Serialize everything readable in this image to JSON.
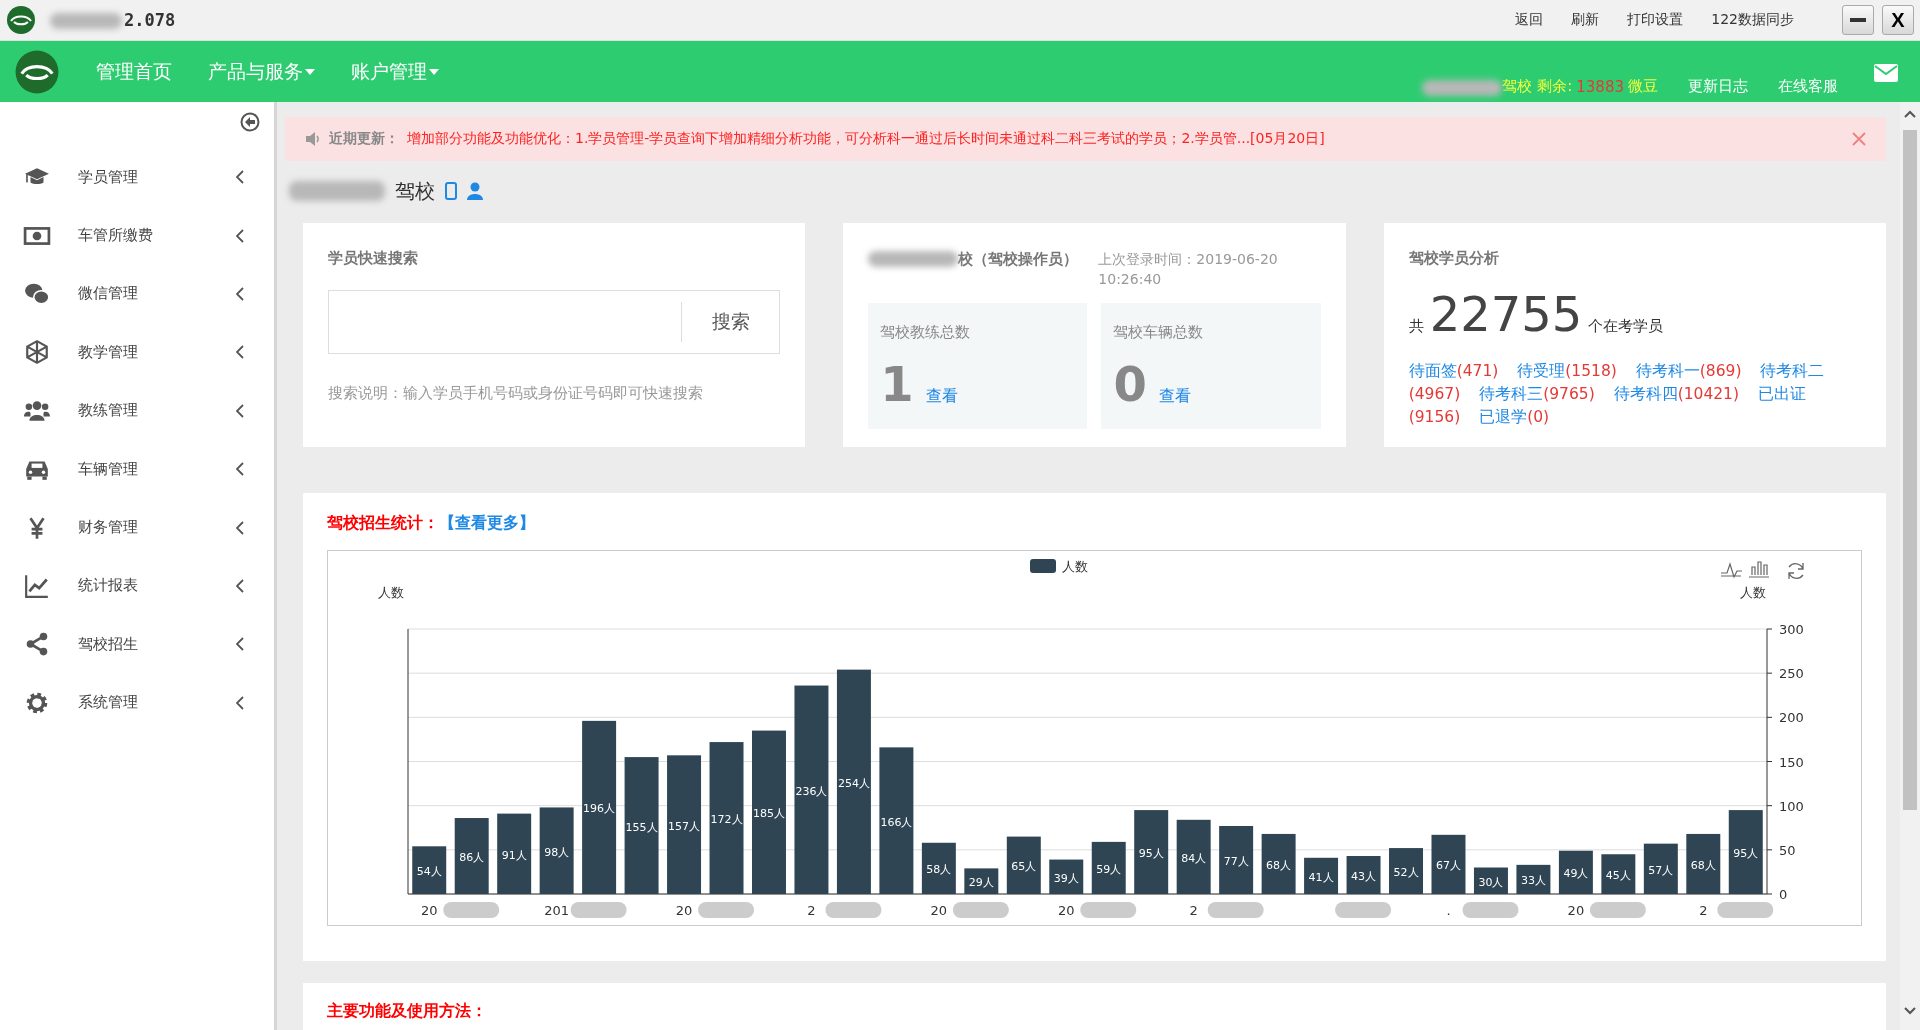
{
  "title_bar": {
    "version": "2.078",
    "links": [
      "返回",
      "刷新",
      "打印设置",
      "122数据同步"
    ],
    "close_label": "X"
  },
  "nav": {
    "items": [
      {
        "label": "管理首页",
        "dropdown": false
      },
      {
        "label": "产品与服务",
        "dropdown": true
      },
      {
        "label": "账户管理",
        "dropdown": true
      }
    ],
    "account": {
      "school_suffix": "驾校",
      "remaining_label": "剩余:",
      "balance": "13883",
      "unit": "微豆"
    },
    "links": [
      "更新日志",
      "在线客服"
    ]
  },
  "sidebar": {
    "items": [
      {
        "label": "学员管理"
      },
      {
        "label": "车管所缴费"
      },
      {
        "label": "微信管理"
      },
      {
        "label": "教学管理"
      },
      {
        "label": "教练管理"
      },
      {
        "label": "车辆管理"
      },
      {
        "label": "财务管理"
      },
      {
        "label": "统计报表"
      },
      {
        "label": "驾校招生"
      },
      {
        "label": "系统管理"
      }
    ]
  },
  "notice": {
    "label": "近期更新：",
    "text": "增加部分功能及功能优化：1.学员管理-学员查询下增加精细分析功能，可分析科一通过后长时间未通过科二科三考试的学员；2.学员管...[05月20日]"
  },
  "school": {
    "name_suffix": "驾校"
  },
  "search_card": {
    "title": "学员快速搜索",
    "button": "搜索",
    "hint": "搜索说明：输入学员手机号码或身份证号码即可快速搜索"
  },
  "operator_card": {
    "name_suffix": "校（驾校操作员）",
    "last_login": "上次登录时间：2019-06-20 10:26:40",
    "stats": [
      {
        "label": "驾校教练总数",
        "value": "1",
        "link": "查看"
      },
      {
        "label": "驾校车辆总数",
        "value": "0",
        "link": "查看"
      }
    ]
  },
  "analysis_card": {
    "title": "驾校学员分析",
    "prefix": "共",
    "total": "22755",
    "suffix": "个在考学员",
    "statuses": [
      {
        "label": "待面签",
        "count": "(471)"
      },
      {
        "label": "待受理",
        "count": "(1518)"
      },
      {
        "label": "待考科一",
        "count": "(869)"
      },
      {
        "label": "待考科二",
        "count": "(4967)"
      },
      {
        "label": "待考科三",
        "count": "(9765)"
      },
      {
        "label": "待考科四",
        "count": "(10421)"
      },
      {
        "label": "已出证",
        "count": "(9156)"
      },
      {
        "label": "已退学",
        "count": "(0)"
      }
    ]
  },
  "enroll_card": {
    "title": "驾校招生统计：",
    "more_link": "【查看更多】",
    "chart_data": {
      "type": "bar",
      "ylabel": "人数",
      "ylim": [
        0,
        300
      ],
      "yticks": [
        0,
        50,
        100,
        150,
        200,
        250,
        300
      ],
      "grid": true,
      "categories": [
        "20",
        null,
        null,
        "201",
        null,
        null,
        "20",
        null,
        null,
        "2",
        null,
        null,
        "20",
        null,
        null,
        "20",
        null,
        null,
        "2",
        null,
        null,
        null,
        null,
        null,
        ".",
        null,
        null,
        "20",
        null,
        null,
        "2",
        null
      ],
      "series": [
        {
          "name": "人数",
          "color": "#2f4554",
          "values": [
            54,
            86,
            91,
            98,
            196,
            155,
            157,
            172,
            185,
            236,
            254,
            166,
            58,
            29,
            65,
            39,
            59,
            95,
            84,
            77,
            68,
            41,
            43,
            52,
            67,
            30,
            33,
            49,
            45,
            57,
            68,
            95
          ]
        }
      ],
      "value_labels": [
        "54人",
        "86人",
        "91人",
        "98人",
        "196人",
        "155人",
        "157人",
        "172人",
        "185人",
        "236人",
        "254人",
        "166人",
        "58人",
        "29人",
        "65人",
        "39人",
        "59人",
        "95人",
        "84人",
        "77人",
        "68人",
        "41人",
        "43人",
        "52人",
        "67人",
        "30人",
        "33人",
        "49人",
        "45人",
        "57人",
        "68人",
        "95人"
      ]
    }
  },
  "usage_card": {
    "title": "主要功能及使用方法："
  }
}
